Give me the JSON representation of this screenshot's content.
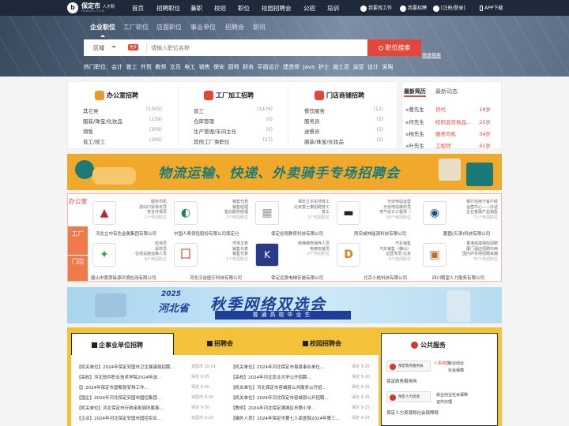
{
  "header": {
    "logo_letter": "b",
    "brand": "保定市",
    "brand_small": "人才网",
    "brand_sub": "HRBDRC.COM",
    "nav": [
      "首页",
      "招聘职位",
      "兼职",
      "校招",
      "职位",
      "校园招聘会",
      "公招",
      "培训"
    ],
    "find_job": "我要找工作",
    "hire": "我要招聘",
    "login": "[注册/登录]",
    "app": "APP下载"
  },
  "search": {
    "tabs": [
      "企业职位",
      "工厂职位",
      "店面职位",
      "事业单位",
      "招聘会",
      "职讯"
    ],
    "region": "区域",
    "more": "更多",
    "placeholder": "请输入职位名称",
    "button": "职位搜索",
    "advanced": "高级搜索",
    "hot_label": "热门职位：",
    "hot": [
      "会计",
      "普工",
      "外贸",
      "教师",
      "文员",
      "电工",
      "销售",
      "保安",
      "厨师",
      "财务",
      "平面设计",
      "建造师",
      "Java",
      "护士",
      "施工员",
      "运营",
      "设计",
      "采购"
    ]
  },
  "categories": [
    {
      "title": "办公室招聘",
      "color": "#e99a2a",
      "items": [
        [
          "其它类",
          "(1305)"
        ],
        [
          "服装/珠宝/化妆品",
          "(239)"
        ],
        [
          "销售",
          "(209)"
        ],
        [
          "普工/技工",
          "(206)"
        ]
      ]
    },
    {
      "title": "工厂加工招聘",
      "color": "#e5463a",
      "items": [
        [
          "普工",
          "(1476)"
        ],
        [
          "仓库管理",
          "(0)"
        ],
        [
          "生产管理/车间主任",
          "(0)"
        ],
        [
          "其他工厂类职位",
          "(27)"
        ]
      ]
    },
    {
      "title": "门店商铺招聘",
      "color": "#e5463a",
      "items": [
        [
          "餐饮服务",
          "(12)"
        ],
        [
          "服务员",
          "(5)"
        ],
        [
          "送餐员",
          "(5)"
        ],
        [
          "服装/珠宝/化妆品",
          "(5)"
        ]
      ]
    }
  ],
  "resumes": {
    "tabs": [
      "最新简历",
      "最新动态"
    ],
    "items": [
      {
        "name": "葛先生",
        "job": "货代",
        "age": "19岁"
      },
      {
        "name": "何先生",
        "job": "纺织品贸易品...",
        "age": "25岁"
      },
      {
        "name": "杨先生",
        "job": "服务司机",
        "age": "34岁"
      },
      {
        "name": "叶先生",
        "job": "工程师",
        "age": "41岁"
      }
    ]
  },
  "banner1": {
    "text": "物流运输、快递、外卖骑手专场招聘会"
  },
  "companies_side": [
    "办公室",
    "工厂",
    "门店"
  ],
  "companies": [
    {
      "name": "河北立中有色金属集团有限公司",
      "desc": [
        "服务司机",
        "进出口贸易专员",
        "安全环保员"
      ],
      "count": "1个热招职位",
      "color": "#c6262b",
      "mark": "▲"
    },
    {
      "name": "中国人寿保险股份有限公司保定分",
      "desc": [
        "销售代表",
        "销售经理",
        "售后服务经理"
      ],
      "count": "3个热招职位",
      "color": "#1a8a4a",
      "mark": "◐"
    },
    {
      "name": "保定谷雨教育科技有限公司",
      "desc": [
        "保定立讯东师普工",
        "北京富士康招聘普工",
        "普工"
      ],
      "count": "3个热招职位",
      "color": "#999",
      "mark": "▦"
    },
    {
      "name": "西安咸林能源科技有限公司",
      "desc": [
        "光伏电站运营",
        "光伏电站维护员",
        "电气设计工程师（"
      ],
      "count": "58个热招职位",
      "color": "#222",
      "mark": "▬"
    },
    {
      "name": "鹏图(天津)科技有限公司",
      "desc": [
        "银行信用卡客户经",
        "运营中心——办证",
        "企业金融产品销售"
      ],
      "count": "71个热招职位",
      "color": "#1d4e8f",
      "mark": "◉"
    },
    {
      "name": "唐山市黄莲接源环境检测有限公司",
      "desc": [
        "检测员",
        "采样员",
        "在线设施运维人员"
      ],
      "count": "6个热招职位",
      "color": "#3aa34a",
      "mark": "✦"
    },
    {
      "name": "河北汉谷医疗科技有限公司",
      "desc": [
        "市场主管",
        "销售代表",
        "销售代表"
      ],
      "count": "1个热招职位",
      "color": "#d43a2a",
      "mark": "囗"
    },
    {
      "name": "保定远景电梯安装有限公司",
      "desc": [
        "电梯维修保养人员",
        "",
        "电梯安装员"
      ],
      "count": "2个热招职位",
      "color": "#2a3a8a",
      "mark": "K"
    },
    {
      "name": "北京小桔科技有限公司",
      "desc": [
        "汽车销售",
        "汽车销售（佛山）",
        "运营专员-北京"
      ],
      "count": "9个热招职位",
      "color": "#f07a1a",
      "mark": "D"
    },
    {
      "name": "四川聘望人力服务有限公司",
      "desc": [
        "香港高端保险招聘",
        "厦门酒店招聘中西",
        "国内外农场招聘采摘"
      ],
      "count": "70个热招职位",
      "color": "#c46a2a",
      "mark": "▣"
    }
  ],
  "banner2": {
    "year": "2025",
    "province": "河北省",
    "title": "秋季网络双选会",
    "sub": "普通高校毕业生"
  },
  "news": {
    "tabs": [
      "企事业单位招聘",
      "招聘会",
      "校园招聘会"
    ],
    "public_title": "公共服务",
    "col1": [
      {
        "t": "【机关单位】2024年保定安国市卫生健康局招聘...",
        "d": "安国市  10-01"
      },
      {
        "t": "【高校】河北软件职业技术学院2024年选...",
        "d": "保定  9-25"
      },
      {
        "t": "【】2024年保定市望都县安排工作...",
        "d": "保定  9-30"
      },
      {
        "t": "【国企】2024年河北保定安国市国控集团...",
        "d": "安国市  9-30"
      },
      {
        "t": "【机关单位】河北保定市行政审批局所属事...",
        "d": "保定  9-30"
      },
      {
        "t": "【企业】2024年河北保定安国市国控实业...",
        "d": "安国市  9-25"
      }
    ],
    "col2": [
      {
        "t": "【机关单位】2024年河北保定市易县事业单位...",
        "d": "保定  9-25"
      },
      {
        "t": "【高校】2024年河北农业大学公开招聘...",
        "d": "保定  9-26"
      },
      {
        "t": "【机关单位】河北保定市容城县公共服务公开招...",
        "d": "保定  9-25"
      },
      {
        "t": "【机关单位】2024年河北保定市容城县公开招聘...",
        "d": "保定  9-25"
      },
      {
        "t": "【教师】2024年河北保定满城区市第小学...",
        "d": "保定  9-25"
      },
      {
        "t": "【编外人员】2024年保定市第七人民医院2024年第三...",
        "d": "保定  9-25"
      }
    ],
    "public": [
      {
        "org": "保定政务服务局",
        "label": "人事档案",
        "label2": "就业创业",
        "label3": "社会保障",
        "caption": "保定政务服务网"
      },
      {
        "org": "保定人力资源",
        "label": "就业创业",
        "label2": "社会保障",
        "label3": "证件办理",
        "caption": "保定人力资源和社会保障局"
      }
    ]
  }
}
